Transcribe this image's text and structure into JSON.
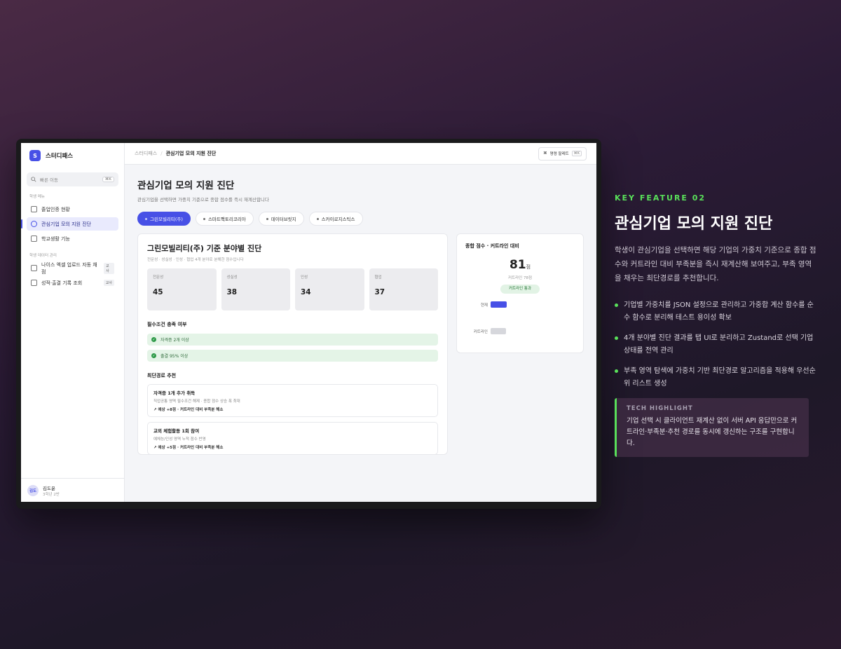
{
  "app": {
    "brand_initial": "S",
    "brand_name": "스터디패스",
    "search_placeholder": "빠른 이동",
    "search_kbd": "⌘K",
    "accent": "#4750e6",
    "green": "#59e05a"
  },
  "sidebar": {
    "student_section": "학생 메뉴",
    "student_items": [
      {
        "label": "졸업인증 현황"
      },
      {
        "label": "관심기업 모의 지원 진단"
      },
      {
        "label": "학교생활 기능"
      }
    ],
    "teacher_section": "학생 데이터 관리",
    "teacher_items": [
      {
        "label": "나이스 엑셀 업로드 자동 채점",
        "badge": "교사"
      },
      {
        "label": "성적·출결 기록 조회",
        "badge": "교사"
      }
    ],
    "user": {
      "initials": "김도",
      "name": "김도윤",
      "meta": "3학년 2반"
    }
  },
  "topbar": {
    "crumb_root": "스터디패스",
    "crumb_current": "관심기업 모의 지원 진단",
    "palette_label": "명령 팔레트",
    "palette_kbd": "⌘K"
  },
  "page": {
    "title": "관심기업 모의 지원 진단",
    "subtitle": "관심기업을 선택하면 가중치 기준으로 종합 점수를 즉시 재계산합니다",
    "tabs": [
      "그린모빌리티(주)",
      "스마트팩토리코리아",
      "데이터브릿지",
      "스카이로지스틱스"
    ]
  },
  "diagnosis": {
    "title": "그린모빌리티(주) 기준 분야별 진단",
    "subtitle": "전문성 · 성실성 · 인성 · 협업 4개 분야로 분해한 점수입니다",
    "scores": [
      {
        "label": "전문성",
        "value": "45"
      },
      {
        "label": "성실성",
        "value": "38"
      },
      {
        "label": "인성",
        "value": "34"
      },
      {
        "label": "협업",
        "value": "37"
      }
    ],
    "req_title": "필수조건 충족 여부",
    "requirements": [
      "자격증 2개 이상",
      "출결 95% 이상"
    ],
    "rec_title": "최단경로 추천",
    "recommendations": [
      {
        "title": "자격증 1개 추가 취득",
        "desc": "직업공통 영역 필수조건 해제 · 종합 점수 상승 폭 최대",
        "effect": "예상 +8점 · 커트라인 대비 부족분 해소"
      },
      {
        "title": "교외 체험활동 1회 참여",
        "desc": "예체능/인성 영역 누적 점수 반영",
        "effect": "예상 +5점 · 커트라인 대비 부족분 해소"
      }
    ]
  },
  "total": {
    "title": "종합 점수 · 커트라인 대비",
    "score": "81",
    "unit": "점",
    "cutline_text": "커트라인 78점",
    "badge": "커트라인 통과",
    "bars": [
      {
        "label": "현재",
        "value": 81,
        "color": "#4750e6"
      },
      {
        "label": "커트라인",
        "value": 78,
        "color": "#d6d7dc"
      }
    ]
  },
  "feature": {
    "kicker": "KEY FEATURE 02",
    "title": "관심기업 모의 지원 진단",
    "desc": "학생이 관심기업을 선택하면 해당 기업의 가중치 기준으로 종합 점수와 커트라인 대비 부족분을 즉시 재계산해 보여주고, 부족 영역을 채우는 최단경로를 추천합니다.",
    "bullets": [
      "기업별 가중치를 JSON 설정으로 관리하고 가중합 계산 함수를 순수 함수로 분리해 테스트 용이성 확보",
      "4개 분야별 진단 결과를 탭 UI로 분리하고 Zustand로 선택 기업 상태를 전역 관리",
      "부족 영역 탐색에 가중치 기반 최단경로 알고리즘을 적용해 우선순위 리스트 생성"
    ],
    "tech_label": "TECH HIGHLIGHT",
    "tech_body": "기업 선택 시 클라이언트 재계산 없이 서버 API 응답만으로 커트라인·부족분·추천 경로를 동시에 갱신하는 구조를 구현합니다."
  }
}
